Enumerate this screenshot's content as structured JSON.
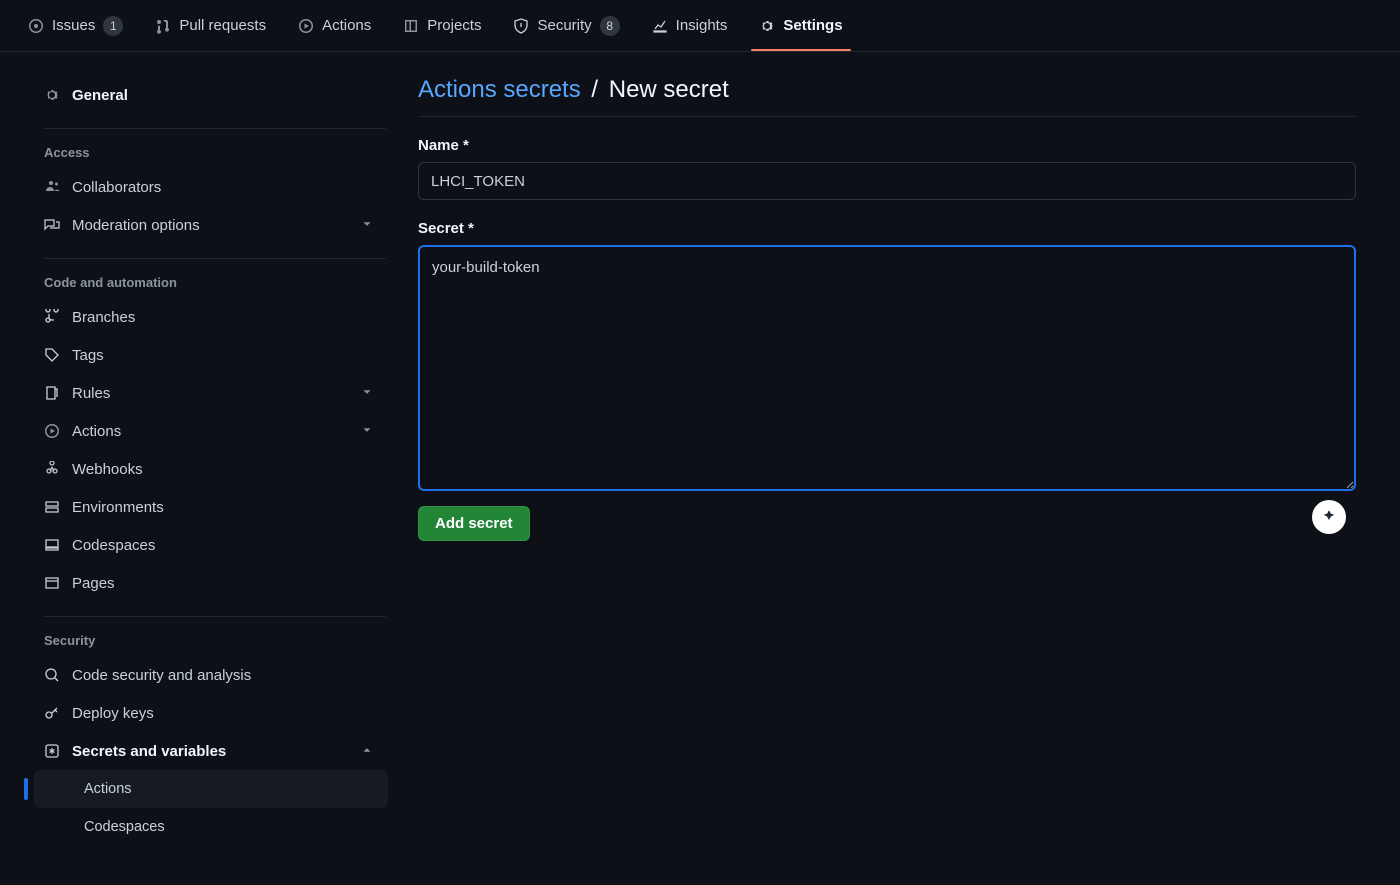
{
  "topnav": {
    "tabs": [
      {
        "label": "Issues",
        "badge": "1"
      },
      {
        "label": "Pull requests"
      },
      {
        "label": "Actions"
      },
      {
        "label": "Projects"
      },
      {
        "label": "Security",
        "badge": "8"
      },
      {
        "label": "Insights"
      },
      {
        "label": "Settings",
        "active": true
      }
    ]
  },
  "sidebar": {
    "general": "General",
    "groups": {
      "access": {
        "title": "Access",
        "items": [
          {
            "label": "Collaborators"
          },
          {
            "label": "Moderation options",
            "chevron": true
          }
        ]
      },
      "code": {
        "title": "Code and automation",
        "items": [
          {
            "label": "Branches"
          },
          {
            "label": "Tags"
          },
          {
            "label": "Rules",
            "chevron": true
          },
          {
            "label": "Actions",
            "chevron": true
          },
          {
            "label": "Webhooks"
          },
          {
            "label": "Environments"
          },
          {
            "label": "Codespaces"
          },
          {
            "label": "Pages"
          }
        ]
      },
      "security": {
        "title": "Security",
        "items": [
          {
            "label": "Code security and analysis"
          },
          {
            "label": "Deploy keys"
          },
          {
            "label": "Secrets and variables",
            "chevron_up": true,
            "bold": true
          }
        ],
        "sub": [
          {
            "label": "Actions",
            "active": true
          },
          {
            "label": "Codespaces"
          }
        ]
      }
    }
  },
  "main": {
    "breadcrumb_link": "Actions secrets",
    "breadcrumb_sep": "/",
    "breadcrumb_current": "New secret",
    "name_label": "Name *",
    "name_value": "LHCI_TOKEN",
    "secret_label": "Secret *",
    "secret_value": "your-build-token",
    "add_button": "Add secret"
  }
}
